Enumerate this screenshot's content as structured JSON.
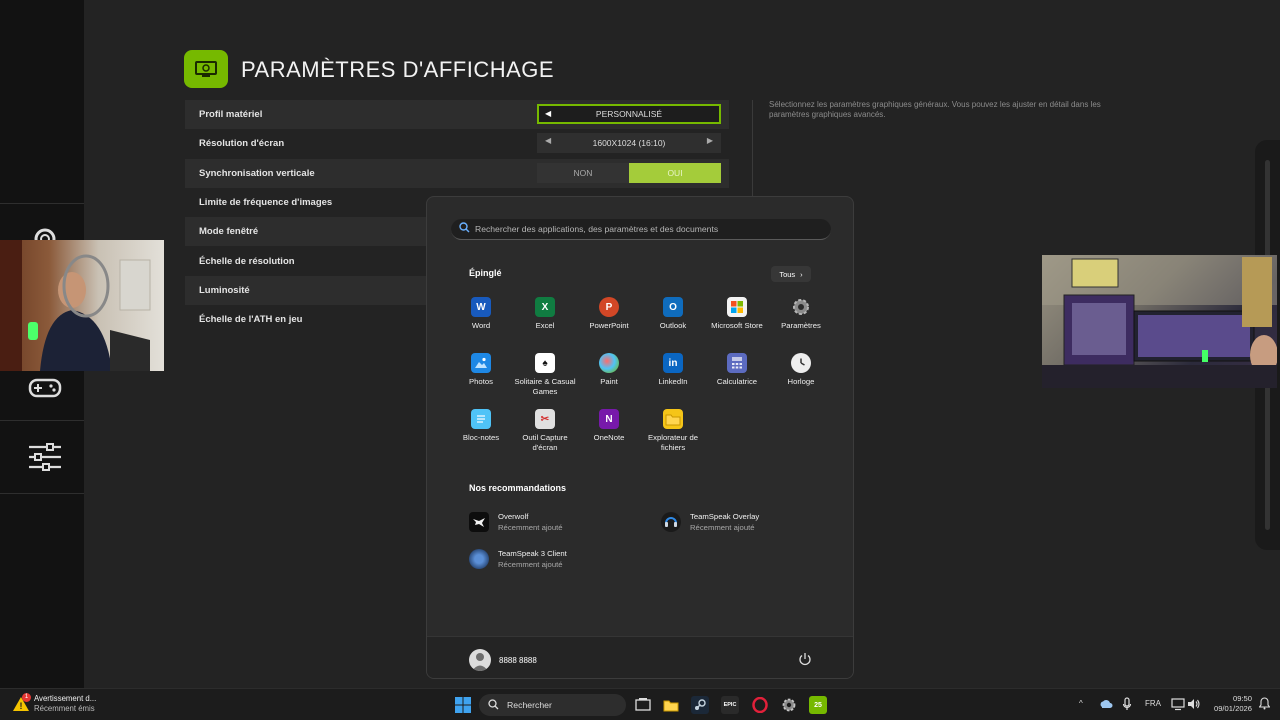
{
  "nvidia_app": {
    "title": "PARAMÈTRES D'AFFICHAGE",
    "help_text": "Sélectionnez les paramètres graphiques généraux. Vous pouvez les ajuster en détail dans les paramètres graphiques avancés.",
    "settings": [
      {
        "label": "Profil matériel",
        "value": "PERSONNALISÉ"
      },
      {
        "label": "Résolution d'écran",
        "value": "1600X1024 (16:10)"
      },
      {
        "label": "Synchronisation verticale",
        "options": [
          "NON",
          "OUI"
        ],
        "selected": "OUI"
      },
      {
        "label": "Limite de fréquence d'images"
      },
      {
        "label": "Mode fenêtré"
      },
      {
        "label": "Échelle de résolution"
      },
      {
        "label": "Luminosité"
      },
      {
        "label": "Échelle de l'ATH en jeu"
      }
    ],
    "accent": "#76b900"
  },
  "start_menu": {
    "search_placeholder": "Rechercher des applications, des paramètres et des documents",
    "pinned_title": "Épinglé",
    "all_label": "Tous",
    "apps": [
      {
        "name": "Word",
        "icon": "word-icon",
        "color": "#185abd"
      },
      {
        "name": "Excel",
        "icon": "excel-icon",
        "color": "#107c41"
      },
      {
        "name": "PowerPoint",
        "icon": "powerpoint-icon",
        "color": "#d24726"
      },
      {
        "name": "Outlook",
        "icon": "outlook-icon",
        "color": "#0f6cbd"
      },
      {
        "name": "Microsoft Store",
        "icon": "store-icon",
        "color": "#f3f3f3"
      },
      {
        "name": "Paramètres",
        "icon": "gear-icon",
        "color": "#6e6e6e"
      },
      {
        "name": "Photos",
        "icon": "photos-icon",
        "color": "#1e88e5"
      },
      {
        "name": "Solitaire & Casual Games",
        "icon": "cards-icon",
        "color": "#2e7d32"
      },
      {
        "name": "Paint",
        "icon": "paint-icon",
        "color": "#1aa0d8"
      },
      {
        "name": "LinkedIn",
        "icon": "linkedin-icon",
        "color": "#0a66c2"
      },
      {
        "name": "Calculatrice",
        "icon": "calculator-icon",
        "color": "#5c6bc0"
      },
      {
        "name": "Horloge",
        "icon": "clock-icon",
        "color": "#9e9e9e"
      },
      {
        "name": "Bloc-notes",
        "icon": "notepad-icon",
        "color": "#4fc3f7"
      },
      {
        "name": "Outil Capture d'écran",
        "icon": "snipping-icon",
        "color": "#e0e0e0"
      },
      {
        "name": "OneNote",
        "icon": "onenote-icon",
        "color": "#7719aa"
      },
      {
        "name": "Explorateur de fichiers",
        "icon": "folder-icon",
        "color": "#f5c518"
      }
    ],
    "recommended_title": "Nos recommandations",
    "recommended": [
      {
        "name": "Overwolf",
        "sub": "Récemment ajouté",
        "icon": "overwolf-icon"
      },
      {
        "name": "TeamSpeak Overlay",
        "sub": "Récemment ajouté",
        "icon": "teamspeak-overlay-icon"
      },
      {
        "name": "TeamSpeak 3 Client",
        "sub": "Récemment ajouté",
        "icon": "teamspeak-icon"
      }
    ],
    "user_name": "8888 8888"
  },
  "taskbar": {
    "notification_title": "Avertissement d...",
    "notification_sub": "Récemment émis",
    "notification_badge": "1",
    "search_label": "Rechercher",
    "language": "FRA",
    "time": "09:50",
    "date": "09/01/2026",
    "epic_label": "EPIC",
    "app25_label": "25"
  }
}
